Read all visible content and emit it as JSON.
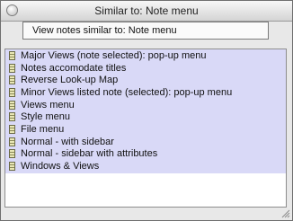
{
  "window": {
    "title": "Similar to: Note menu"
  },
  "header": {
    "label": "View notes similar to: Note menu"
  },
  "list": {
    "items": [
      {
        "label": "Major Views (note selected): pop-up menu"
      },
      {
        "label": "Notes accomodate titles"
      },
      {
        "label": "Reverse Look-up Map"
      },
      {
        "label": "Minor Views listed note (selected): pop-up menu"
      },
      {
        "label": "Views menu"
      },
      {
        "label": "Style menu"
      },
      {
        "label": "File menu"
      },
      {
        "label": "Normal - with sidebar"
      },
      {
        "label": "Normal - sidebar with attributes"
      },
      {
        "label": "Windows & Views"
      }
    ],
    "highlight_color": "#d9d9f7",
    "icon": "note-icon"
  }
}
